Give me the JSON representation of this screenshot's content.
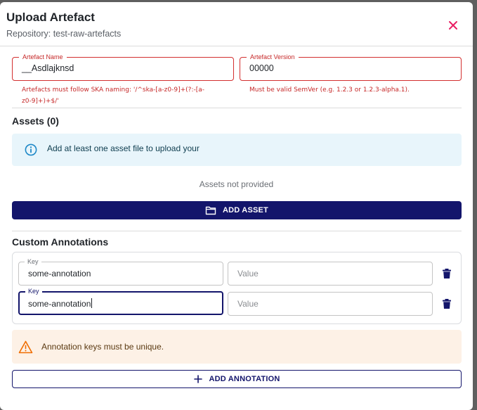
{
  "dialog": {
    "title": "Upload Artefact",
    "subtitle": "Repository: test-raw-artefacts",
    "close_icon": "close-icon"
  },
  "artefact_name": {
    "label": "Artefact Name",
    "value": "__Asdlajknsd",
    "error_line1": "Artefacts must follow SKA naming: '/^ska-[a-z0-9]+(?:-[a-",
    "error_line2": "z0-9]+)+$/'"
  },
  "artefact_version": {
    "label": "Artefact Version",
    "value": "00000",
    "error": "Must be valid SemVer (e.g. 1.2.3 or 1.2.3-alpha.1)."
  },
  "assets": {
    "title": "Assets (0)",
    "info_text": "Add at least one asset file to upload your",
    "info_icon": "info-icon",
    "empty_text": "Assets not provided",
    "add_label": "ADD ASSET",
    "add_icon": "folder-icon"
  },
  "annotations": {
    "title": "Custom Annotations",
    "rows": [
      {
        "key_label": "Key",
        "key_value": "some-annotation",
        "value_placeholder": "Value"
      },
      {
        "key_label": "Key",
        "key_value": "some-annotation",
        "value_placeholder": "Value"
      }
    ],
    "warning_text": "Annotation keys must be unique.",
    "warning_icon": "warning-icon",
    "add_label": "ADD ANNOTATION",
    "add_icon": "plus-icon",
    "delete_icon": "trash-icon"
  },
  "colors": {
    "primary": "#13156b",
    "error": "#d32f2f",
    "close": "#e91e63",
    "info_bg": "#e8f5fb",
    "info_icon": "#1e88c7",
    "warning_bg": "#fdf1e6",
    "warning_icon": "#ef6c00"
  }
}
